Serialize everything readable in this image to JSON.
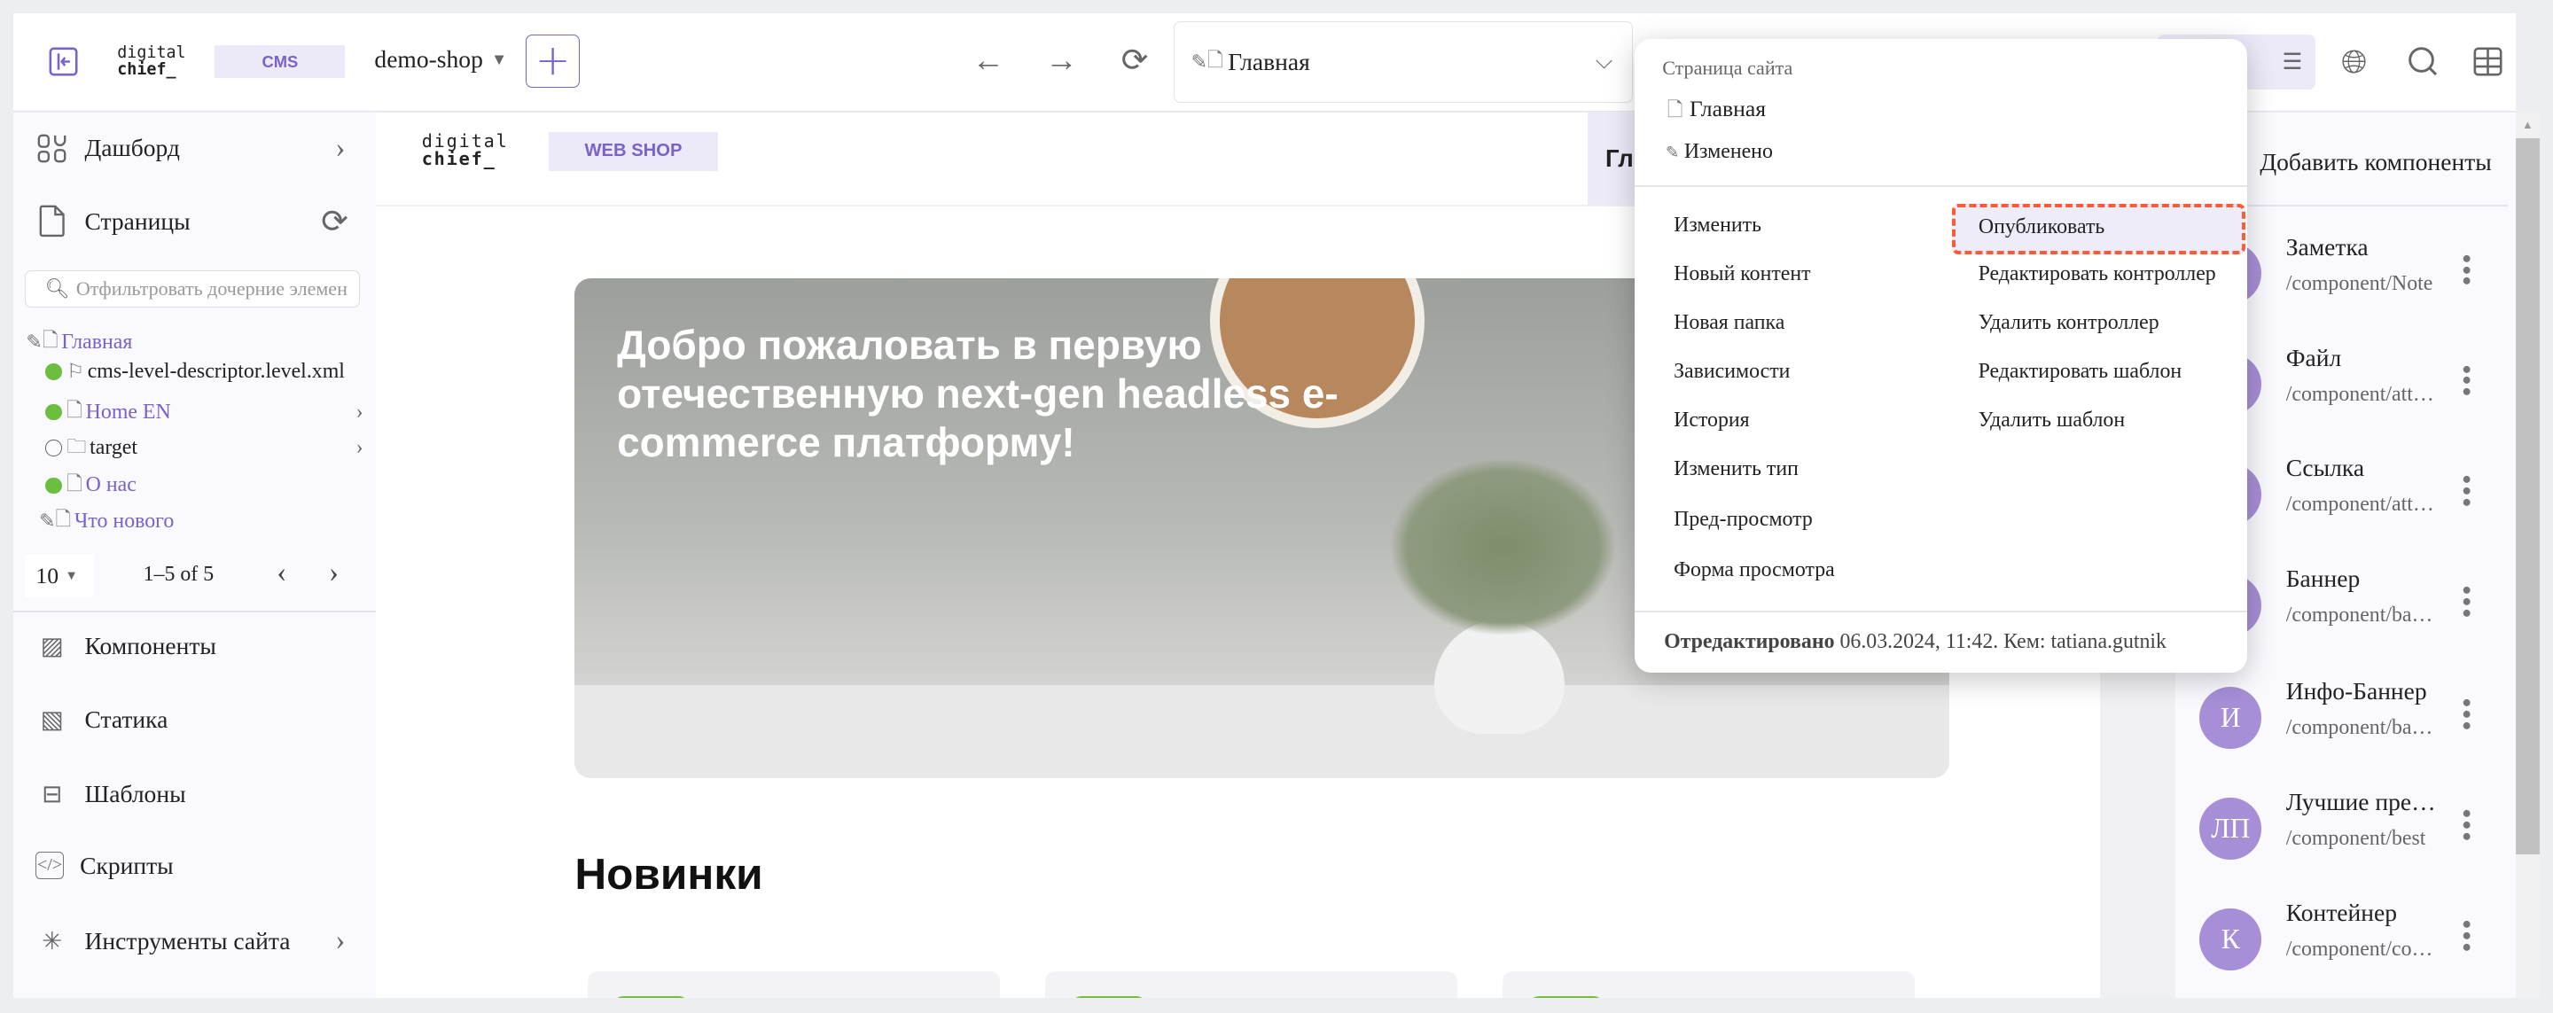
{
  "topbar": {
    "logo_line1": "digital",
    "logo_line2": "chief_",
    "cms_badge": "CMS",
    "site": "demo-shop",
    "add_label": "+",
    "page_selector": "Главная"
  },
  "sidebar": {
    "items_top": [
      {
        "label": "Дашборд",
        "icon": "dashboard-icon"
      },
      {
        "label": "Страницы",
        "icon": "page-icon"
      }
    ],
    "filter_placeholder": "Отфильтровать дочерние элемен",
    "tree": [
      {
        "label": "Главная",
        "status": "edited",
        "type": "page"
      },
      {
        "label": "cms-level-descriptor.level.xml",
        "status": "published",
        "type": "flag"
      },
      {
        "label": "Home EN",
        "status": "published",
        "type": "page",
        "expandable": true
      },
      {
        "label": "target",
        "status": "none",
        "type": "folder",
        "expandable": true
      },
      {
        "label": "О нас",
        "status": "published",
        "type": "page"
      },
      {
        "label": "Что нового",
        "status": "edited",
        "type": "page"
      }
    ],
    "pagination": {
      "per_page": "10",
      "range": "1–5 of 5"
    },
    "items_bottom": [
      {
        "label": "Компоненты",
        "icon": "components-icon"
      },
      {
        "label": "Статика",
        "icon": "image-icon"
      },
      {
        "label": "Шаблоны",
        "icon": "template-icon"
      },
      {
        "label": "Скрипты",
        "icon": "code-icon"
      },
      {
        "label": "Инструменты сайта",
        "icon": "tools-icon"
      }
    ]
  },
  "preview": {
    "logo_line1": "digital",
    "logo_line2": "chief_",
    "badge": "WEB SHOP",
    "nav_partial": "Гл",
    "banner_text": "Добро пожаловать в первую отечественную next-gen headless e-commerce платформу!",
    "section_title": "Новинки"
  },
  "context_menu": {
    "header": "Страница сайта",
    "page_name": "Главная",
    "state": "Изменено",
    "left_items": [
      "Изменить",
      "Новый контент",
      "Новая папка",
      "Зависимости",
      "История",
      "Изменить тип",
      "Пред-просмотр",
      "Форма просмотра"
    ],
    "right_items": [
      "Опубликовать",
      "Редактировать контроллер",
      "Удалить контроллер",
      "Редактировать шаблон",
      "Удалить шаблон"
    ],
    "footer_label": "Отредактировано",
    "footer_value": "06.03.2024, 11:42. Кем: tatiana.gutnik",
    "highlight_color": "#ff5a36"
  },
  "components_panel": {
    "title": "Добавить компоненты",
    "items": [
      {
        "initials": "",
        "name": "Заметка",
        "path": "/component/Note"
      },
      {
        "initials": "",
        "name": "Файл",
        "path": "/component/attachment"
      },
      {
        "initials": "",
        "name": "Ссылка",
        "path": "/component/attachment"
      },
      {
        "initials": "",
        "name": "Баннер",
        "path": "/component/banner"
      },
      {
        "initials": "И",
        "name": "Инфо-Баннер",
        "path": "/component/banner"
      },
      {
        "initials": "ЛП",
        "name": "Лучшие пре…",
        "path": "/component/best"
      },
      {
        "initials": "К",
        "name": "Контейнер",
        "path": "/component/container"
      }
    ]
  },
  "colors": {
    "accent": "#7b62c9",
    "published": "#6cbf3e",
    "avatar": "#a68fd6"
  }
}
